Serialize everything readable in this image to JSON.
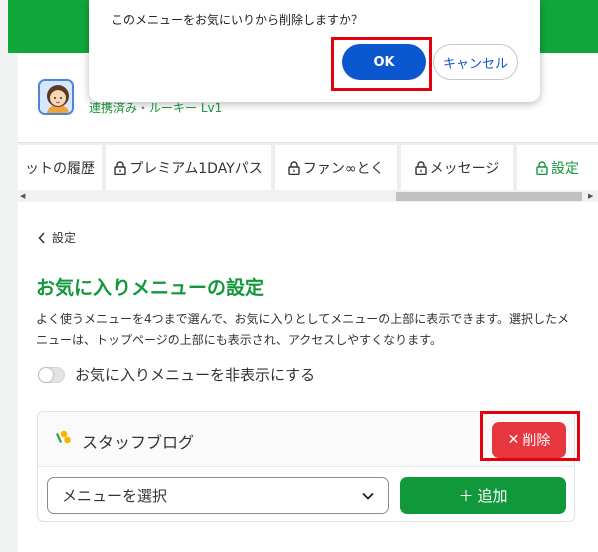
{
  "dialog": {
    "message": "このメニューをお気にいりから削除しますか？",
    "ok_label": "OK",
    "cancel_label": "キャンセル"
  },
  "profile": {
    "status_linked": "連携済み",
    "separator": "・",
    "rank": "ルーキー Lv1"
  },
  "tabs": [
    {
      "label": "ットの履歴",
      "locked": false
    },
    {
      "label": "プレミアム1DAYパス",
      "locked": true
    },
    {
      "label": "ファン∞とく",
      "locked": true
    },
    {
      "label": "メッセージ",
      "locked": true
    },
    {
      "label": "設定",
      "locked": true,
      "active": true
    }
  ],
  "breadcrumb": {
    "back_label": "設定"
  },
  "settings": {
    "title": "お気に入りメニューの設定",
    "description": "よく使うメニューを4つまで選んで、お気に入りとしてメニューの上部に表示できます。選択したメニューは、トップページの上部にも表示され、アクセスしやすくなります。",
    "toggle_label": "お気に入りメニューを非表示にする",
    "toggle_on": false
  },
  "favorite_card": {
    "item_label": "スタッフブログ",
    "delete_label": "削除",
    "select_value": "メニューを選択",
    "add_label": "追加"
  },
  "colors": {
    "brand_green": "#11a63a",
    "delete_red": "#e8363f",
    "ok_blue": "#0b57d0",
    "highlight_red": "#e5000f"
  }
}
